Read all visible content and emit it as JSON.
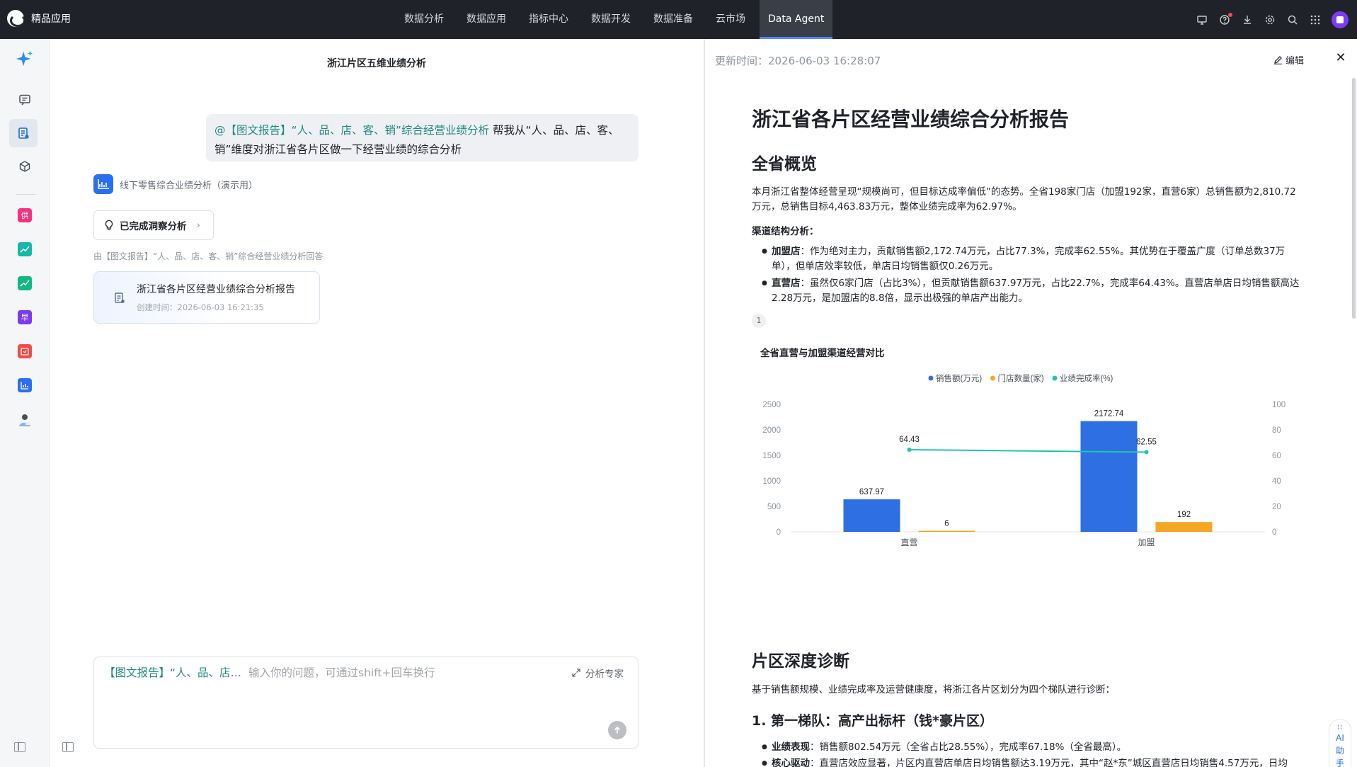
{
  "brand": {
    "name": "精品应用"
  },
  "nav": {
    "items": [
      {
        "label": "数据分析"
      },
      {
        "label": "数据应用"
      },
      {
        "label": "指标中心"
      },
      {
        "label": "数据开发"
      },
      {
        "label": "数据准备"
      },
      {
        "label": "云市场"
      },
      {
        "label": "Data Agent",
        "active": true
      }
    ]
  },
  "rail": {
    "app_tiles": [
      {
        "glyph": "供",
        "color": "#f5317f"
      },
      {
        "glyph": "",
        "color": "#14b8a6"
      },
      {
        "glyph": "",
        "color": "#10b981"
      },
      {
        "glyph": "早",
        "color": "#7c3aed"
      },
      {
        "glyph": "",
        "color": "#f54a45"
      },
      {
        "glyph": "",
        "color": "#2a6ff0"
      }
    ]
  },
  "chat": {
    "title": "浙江片区五维业绩分析",
    "user_message": {
      "mention": "@【图文报告】“人、品、店、客、销”综合经营业绩分析",
      "text": " 帮我从“人、品、店、客、销”维度对浙江省各片区做一下经营业绩的综合分析"
    },
    "agent_name": "线下零售综合业绩分析（演示用）",
    "insight_button": "已完成洞察分析",
    "source_note": "由【图文报告】“人、品、店、客、销”综合经营业绩分析回答",
    "report_card": {
      "title": "浙江省各片区经营业绩综合分析报告",
      "created": "创建时间：2026-06-03 16:21:35"
    },
    "composer": {
      "tag": "【图文报告】“人、品、店…",
      "placeholder": "输入你的问题，可通过shift+回车换行",
      "expert_label": "分析专家"
    }
  },
  "report": {
    "update_time": "更新时间：2026-06-03 16:28:07",
    "edit_label": "编辑",
    "title": "浙江省各片区经营业绩综合分析报告",
    "section1": {
      "heading": "全省概览",
      "intro": "本月浙江省整体经营呈现“规模尚可，但目标达成率偏低”的态势。全省198家门店（加盟192家，直营6家）总销售额为2,810.72万元，总销售目标4,463.83万元，整体业绩完成率为62.97%。",
      "channel_label": "渠道结构分析：",
      "bullets": [
        {
          "term": "加盟店",
          "text": "：作为绝对主力，贡献销售额2,172.74万元，占比77.3%，完成率62.55%。其优势在于覆盖广度（订单总数37万单），但单店效率较低，单店日均销售额仅0.26万元。"
        },
        {
          "term": "直营店",
          "text": "：虽然仅6家门店（占比3%），但贡献销售额637.97万元，占比22.7%，完成率64.43%。直营店单店日均销售额高达2.28万元，是加盟店的8.8倍，显示出极强的单店产出能力。"
        }
      ],
      "ref": "1"
    },
    "section2": {
      "heading": "片区深度诊断",
      "intro": "基于销售额规模、业绩完成率及运营健康度，将浙江各片区划分为四个梯队进行诊断：",
      "tier1_heading": "1. 第一梯队：高产出标杆（钱*豪片区）",
      "bullets": [
        {
          "term": "业绩表现",
          "text": "：销售额802.54万元（全省占比28.55%），完成率67.18%（全省最高）。"
        },
        {
          "term": "核心驱动",
          "text": "：直营店效应显著，片区内直营店单店日均销售额达3.19万元，其中“赵*东”城区直营店日均销售4.57万元，日均"
        }
      ]
    }
  },
  "chart_data": {
    "type": "bar",
    "title": "全省直营与加盟渠道经营对比",
    "categories": [
      "直营",
      "加盟"
    ],
    "series": [
      {
        "name": "销售额(万元)",
        "type": "bar",
        "axis": "left",
        "color": "#2f6fe4",
        "values": [
          637.97,
          2172.74
        ]
      },
      {
        "name": "门店数量(家)",
        "type": "bar",
        "axis": "left",
        "color": "#f5a623",
        "values": [
          6,
          192
        ]
      },
      {
        "name": "业绩完成率(%)",
        "type": "line",
        "axis": "right",
        "color": "#20c4b0",
        "values": [
          64.43,
          62.55
        ]
      }
    ],
    "y_left": {
      "ticks": [
        0,
        500,
        1000,
        1500,
        2000,
        2500
      ],
      "range": [
        0,
        2500
      ]
    },
    "y_right": {
      "ticks": [
        0,
        20,
        40,
        60,
        80,
        100
      ],
      "range": [
        0,
        100
      ]
    },
    "legend": "top-center",
    "grid": false
  },
  "ai_assistant": {
    "label": "AI助手"
  }
}
